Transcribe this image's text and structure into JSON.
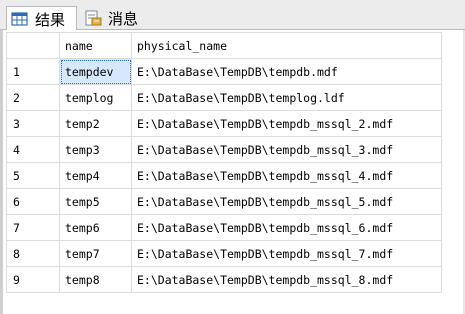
{
  "tabs": [
    {
      "label": "结果",
      "icon": "grid-icon",
      "active": true
    },
    {
      "label": "消息",
      "icon": "message-icon",
      "active": false
    }
  ],
  "grid": {
    "columns": [
      "",
      "name",
      "physical_name"
    ],
    "rows": [
      {
        "num": "1",
        "name": "tempdev",
        "physical_name": "E:\\DataBase\\TempDB\\tempdb.mdf"
      },
      {
        "num": "2",
        "name": "templog",
        "physical_name": "E:\\DataBase\\TempDB\\templog.ldf"
      },
      {
        "num": "3",
        "name": "temp2",
        "physical_name": "E:\\DataBase\\TempDB\\tempdb_mssql_2.mdf"
      },
      {
        "num": "4",
        "name": "temp3",
        "physical_name": "E:\\DataBase\\TempDB\\tempdb_mssql_3.mdf"
      },
      {
        "num": "5",
        "name": "temp4",
        "physical_name": "E:\\DataBase\\TempDB\\tempdb_mssql_4.mdf"
      },
      {
        "num": "6",
        "name": "temp5",
        "physical_name": "E:\\DataBase\\TempDB\\tempdb_mssql_5.mdf"
      },
      {
        "num": "7",
        "name": "temp6",
        "physical_name": "E:\\DataBase\\TempDB\\tempdb_mssql_6.mdf"
      },
      {
        "num": "8",
        "name": "temp7",
        "physical_name": "E:\\DataBase\\TempDB\\tempdb_mssql_7.mdf"
      },
      {
        "num": "9",
        "name": "temp8",
        "physical_name": "E:\\DataBase\\TempDB\\tempdb_mssql_8.mdf"
      }
    ]
  },
  "colors": {
    "selection": "#d6e8fb",
    "gridline": "#dcdcdc",
    "tabbar": "#ececec"
  }
}
